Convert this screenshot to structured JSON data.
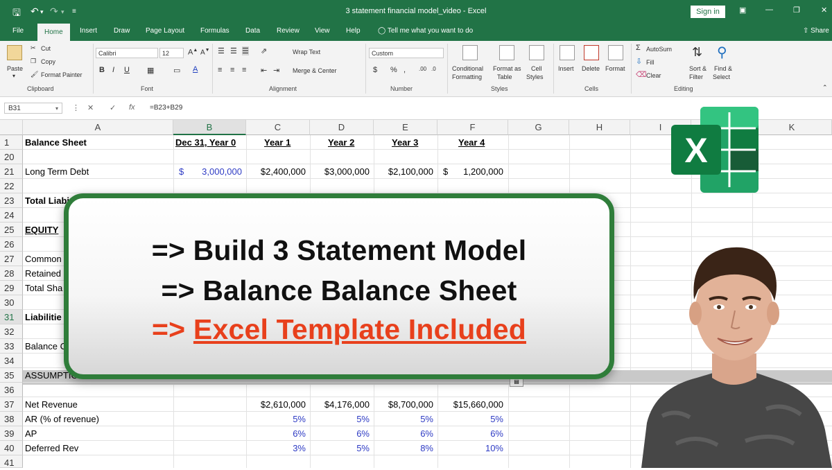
{
  "window": {
    "title": "3 statement financial model_video  -  Excel",
    "sign_in": "Sign in"
  },
  "tabs": [
    "File",
    "Home",
    "Insert",
    "Draw",
    "Page Layout",
    "Formulas",
    "Data",
    "Review",
    "View",
    "Help"
  ],
  "tell_me": "Tell me what you want to do",
  "share": "Share",
  "ribbon": {
    "clipboard": {
      "paste": "Paste",
      "cut": "Cut",
      "copy": "Copy",
      "format_painter": "Format Painter",
      "label": "Clipboard"
    },
    "font": {
      "name": "Calibri",
      "size": "12",
      "label": "Font"
    },
    "alignment": {
      "wrap_text": "Wrap Text",
      "merge_center": "Merge & Center",
      "label": "Alignment"
    },
    "number": {
      "format": "Custom",
      "label": "Number"
    },
    "styles": {
      "conditional": "Conditional",
      "formatting": "Formatting",
      "format_as": "Format as",
      "table": "Table",
      "cell": "Cell",
      "styles": "Styles",
      "label": "Styles"
    },
    "cells": {
      "insert": "Insert",
      "delete": "Delete",
      "format": "Format",
      "label": "Cells"
    },
    "editing": {
      "autosum": "AutoSum",
      "fill": "Fill",
      "clear": "Clear",
      "sort": "Sort &",
      "filter": "Filter",
      "find": "Find &",
      "select": "Select",
      "label": "Editing"
    }
  },
  "formula_bar": {
    "name_box": "B31",
    "formula": "=B23+B29"
  },
  "columns": [
    "A",
    "B",
    "C",
    "D",
    "E",
    "F",
    "G",
    "H",
    "I",
    "J",
    "K"
  ],
  "rows": [
    {
      "num": "1",
      "a": "Balance Sheet",
      "b": "Dec 31, Year 0",
      "c": "Year 1",
      "d": "Year 2",
      "e": "Year 3",
      "f": "Year 4"
    },
    {
      "num": "20",
      "a": "",
      "b": "",
      "c": "",
      "d": "",
      "e": "",
      "f": ""
    },
    {
      "num": "21",
      "a": "Long Term Debt",
      "b_sym": "$",
      "b": "3,000,000",
      "c": "$2,400,000",
      "d": "$3,000,000",
      "e": "$2,100,000",
      "f_sym": "$",
      "f": "1,200,000"
    },
    {
      "num": "22",
      "a": ""
    },
    {
      "num": "23",
      "a": "Total Liabi"
    },
    {
      "num": "24",
      "a": ""
    },
    {
      "num": "25",
      "a": "EQUITY"
    },
    {
      "num": "26",
      "a": ""
    },
    {
      "num": "27",
      "a": "Common"
    },
    {
      "num": "28",
      "a": "Retained"
    },
    {
      "num": "29",
      "a": "Total Sha"
    },
    {
      "num": "30",
      "a": ""
    },
    {
      "num": "31",
      "a": "Liabilitie"
    },
    {
      "num": "32",
      "a": ""
    },
    {
      "num": "33",
      "a": "Balance C"
    },
    {
      "num": "34",
      "a": ""
    },
    {
      "num": "35",
      "a": "ASSUMPTIONS"
    },
    {
      "num": "36",
      "a": ""
    },
    {
      "num": "37",
      "a": "Net Revenue",
      "c": "$2,610,000",
      "d": "$4,176,000",
      "e": "$8,700,000",
      "f": "$15,660,000"
    },
    {
      "num": "38",
      "a": "AR (% of revenue)",
      "c": "5%",
      "d": "5%",
      "e": "5%",
      "f": "5%"
    },
    {
      "num": "39",
      "a": "AP",
      "c": "6%",
      "d": "6%",
      "e": "6%",
      "f": "6%"
    },
    {
      "num": "40",
      "a": "Deferred Rev",
      "c": "3%",
      "d": "5%",
      "e": "8%",
      "f": "10%"
    },
    {
      "num": "41",
      "a": ""
    }
  ],
  "overlay": {
    "line1": "=> Build 3 Statement Model",
    "line2": "=> Balance Balance Sheet",
    "line3_prefix": "=> ",
    "line3_text": "Excel Template Included"
  },
  "colors": {
    "excel_green": "#217346",
    "card_border": "#2f7d3a",
    "highlight_red": "#e8401c",
    "input_blue": "#2e3bc4"
  },
  "icons": [
    "save-icon",
    "undo-icon",
    "redo-icon",
    "lightbulb-icon",
    "excel-logo-icon"
  ]
}
